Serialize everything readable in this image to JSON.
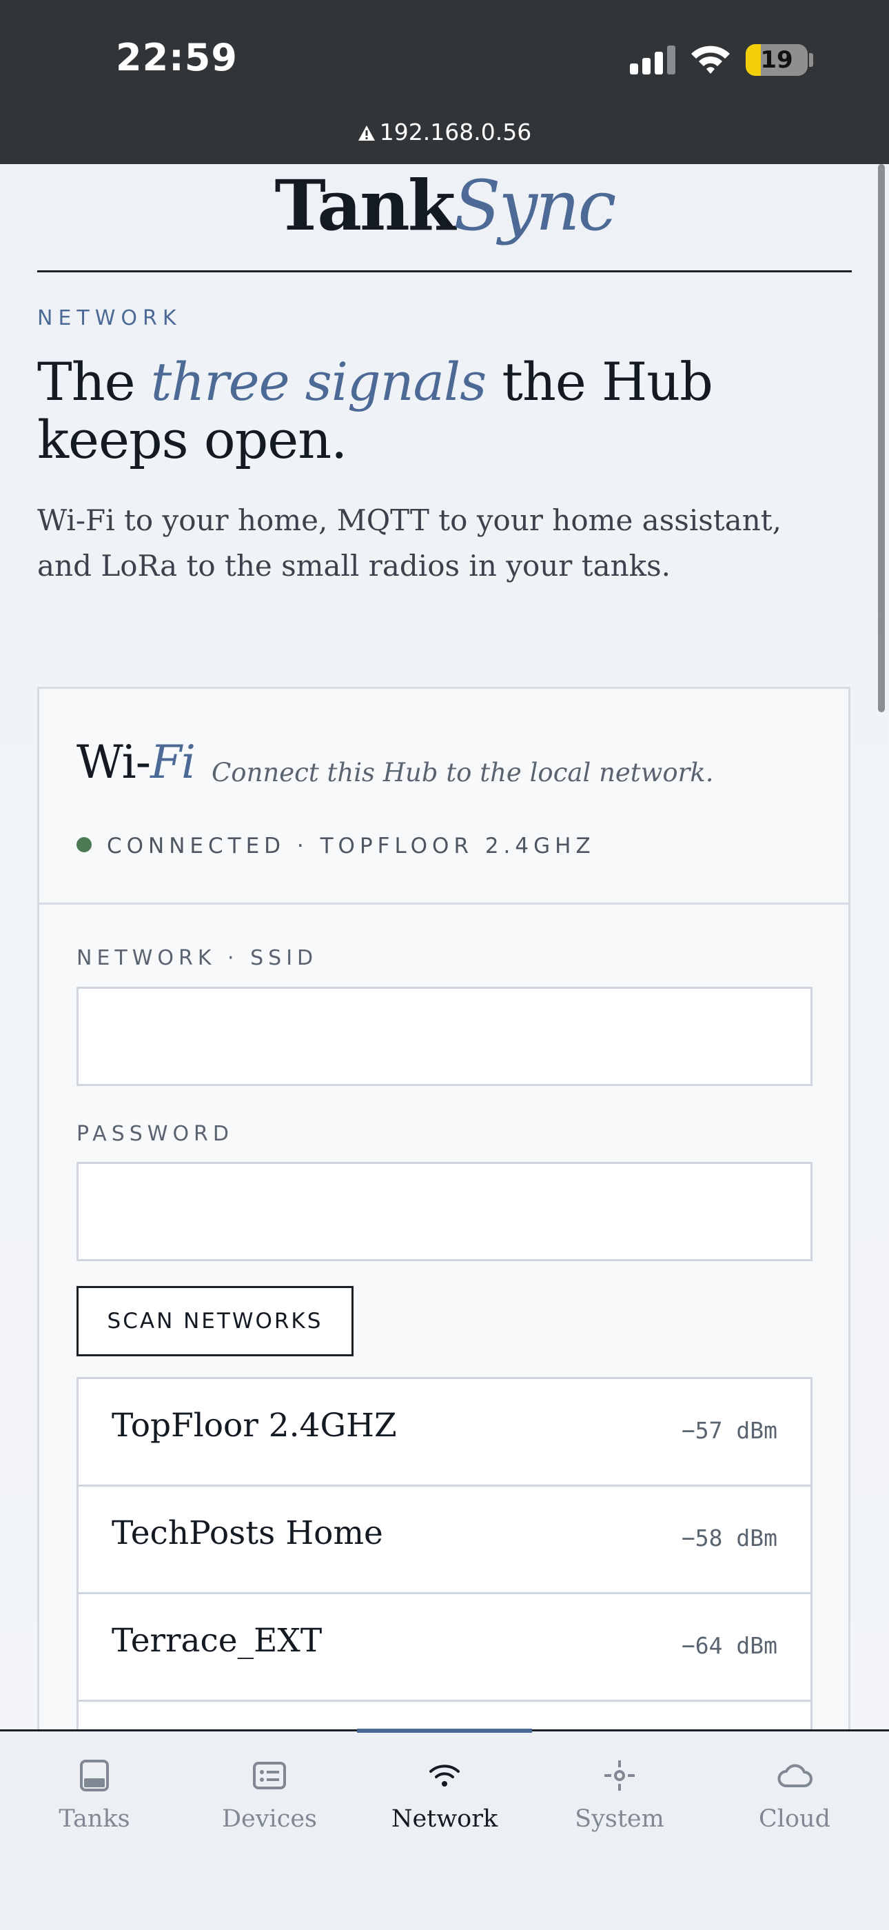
{
  "status_bar": {
    "time": "22:59",
    "battery": "19",
    "url": "192.168.0.56"
  },
  "brand": {
    "part1": "Tank",
    "part2": "Sync"
  },
  "intro": {
    "eyebrow": "NETWORK",
    "headline_pre": "The ",
    "headline_em": "three signals",
    "headline_post": " the Hub keeps open.",
    "lede": "Wi-Fi to your home, MQTT to your home assistant, and LoRa to the small radios in your tanks."
  },
  "wifi_card": {
    "title_pre": "Wi-",
    "title_em": "Fi",
    "subtitle": "Connect this Hub to the local network.",
    "status": "CONNECTED · TOPFLOOR 2.4GHZ",
    "status_color": "#4c7a52",
    "ssid_label": "NETWORK · SSID",
    "ssid_value": "",
    "password_label": "PASSWORD",
    "password_value": "",
    "scan_button": "SCAN NETWORKS",
    "networks": [
      {
        "name": "TopFloor 2.4GHZ",
        "rssi": "−57 dBm"
      },
      {
        "name": "TechPosts Home",
        "rssi": "−58 dBm"
      },
      {
        "name": "Terrace_EXT",
        "rssi": "−64 dBm"
      },
      {
        "name": "",
        "rssi": ""
      }
    ]
  },
  "tabs": [
    {
      "label": "Tanks",
      "icon": "tank-icon",
      "active": false
    },
    {
      "label": "Devices",
      "icon": "devices-icon",
      "active": false
    },
    {
      "label": "Network",
      "icon": "wifi-icon",
      "active": true
    },
    {
      "label": "System",
      "icon": "system-icon",
      "active": false
    },
    {
      "label": "Cloud",
      "icon": "cloud-icon",
      "active": false
    }
  ],
  "colors": {
    "accent": "#4c6a95",
    "ink": "#141a22",
    "status_bar": "#323538"
  }
}
